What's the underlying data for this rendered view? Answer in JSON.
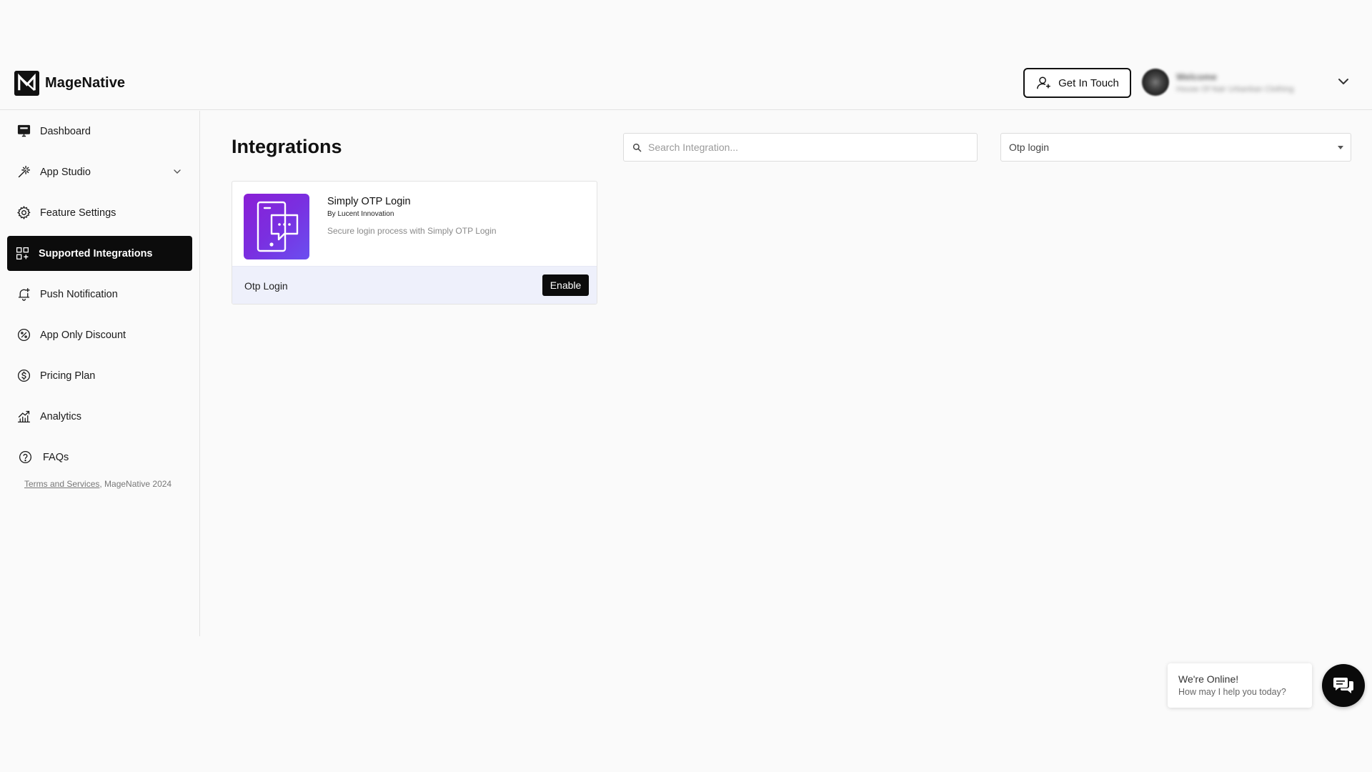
{
  "brand": {
    "name": "MageNative"
  },
  "header": {
    "get_in_touch_label": "Get In Touch",
    "account_welcome": "Welcome",
    "account_store": "House Of Nair Urbanban Clothing"
  },
  "sidebar": {
    "items": [
      {
        "label": "Dashboard",
        "icon": "dashboard-icon"
      },
      {
        "label": "App Studio",
        "icon": "magic-wand-icon"
      },
      {
        "label": "Feature Settings",
        "icon": "gear-icon"
      },
      {
        "label": "Supported Integrations",
        "icon": "grid-plus-icon"
      },
      {
        "label": "Push Notification",
        "icon": "bell-icon"
      },
      {
        "label": "App Only Discount",
        "icon": "percent-icon"
      },
      {
        "label": "Pricing Plan",
        "icon": "dollar-icon"
      },
      {
        "label": "Analytics",
        "icon": "chart-icon"
      },
      {
        "label": "FAQs",
        "icon": "question-icon"
      }
    ],
    "footer_link": "Terms and Services",
    "footer_text": ", MageNative 2024"
  },
  "main": {
    "title": "Integrations",
    "search_placeholder": "Search Integration...",
    "filter_value": "Otp login",
    "cards": [
      {
        "title": "Simply OTP Login",
        "vendor": "By Lucent Innovation",
        "description": "Secure login process with Simply OTP Login",
        "tag": "Otp Login",
        "action_label": "Enable"
      }
    ]
  },
  "chat": {
    "title": "We're Online!",
    "subtitle": "How may I help you today?"
  },
  "colors": {
    "accent": "#0c0c0c",
    "card_footer": "#eef0fb",
    "logo_gradient_start": "#8a1fd6",
    "logo_gradient_end": "#6a4ff0"
  }
}
